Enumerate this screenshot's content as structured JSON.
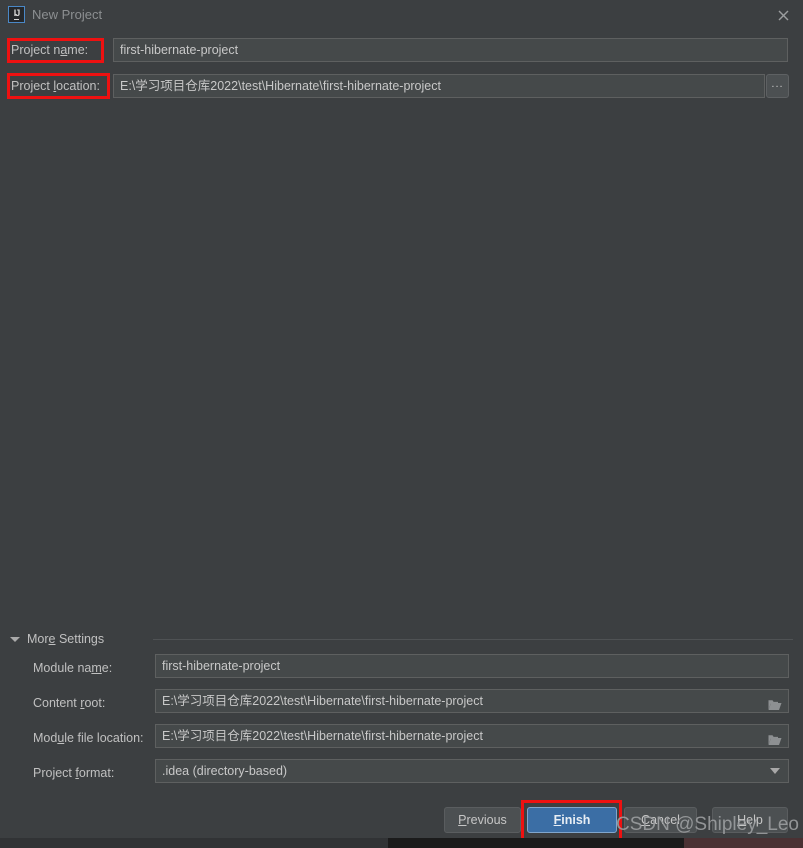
{
  "window": {
    "title": "New Project",
    "app_icon": "intellij-idea-icon",
    "icon_text": "IJ",
    "close_icon": "close-icon"
  },
  "top_form": {
    "project_name": {
      "label_pre": "Project n",
      "label_accel": "a",
      "label_post": "me:",
      "value": "first-hibernate-project"
    },
    "project_location": {
      "label_pre": "Project ",
      "label_accel": "l",
      "label_post": "ocation:",
      "value": "E:\\学习项目仓库2022\\test\\Hibernate\\first-hibernate-project"
    },
    "browse_button_label": "..."
  },
  "more_settings": {
    "header_pre": "Mor",
    "header_accel": "e",
    "header_post": " Settings",
    "expanded": true,
    "fields": [
      {
        "name": "module-name",
        "label_pre": "Module na",
        "label_accel": "m",
        "label_post": "e:",
        "value": "first-hibernate-project",
        "control": "text"
      },
      {
        "name": "content-root",
        "label_pre": "Content ",
        "label_accel": "r",
        "label_post": "oot:",
        "value": "E:\\学习项目仓库2022\\test\\Hibernate\\first-hibernate-project",
        "control": "text-with-folder"
      },
      {
        "name": "module-file-location",
        "label_pre": "Mod",
        "label_accel": "u",
        "label_post": "le file location:",
        "value": "E:\\学习项目仓库2022\\test\\Hibernate\\first-hibernate-project",
        "control": "text-with-folder"
      },
      {
        "name": "project-format",
        "label_pre": "Project ",
        "label_accel": "f",
        "label_post": "ormat:",
        "value": ".idea (directory-based)",
        "control": "combobox"
      }
    ]
  },
  "buttons": {
    "previous": {
      "pre": "",
      "accel": "P",
      "post": "revious"
    },
    "finish": {
      "pre": "",
      "accel": "F",
      "post": "inish"
    },
    "cancel": {
      "pre": "",
      "accel": "C",
      "post": "ancel"
    },
    "help": {
      "pre": "",
      "accel": "H",
      "post": "elp"
    }
  },
  "annotations": {
    "color": "#ee1111",
    "boxes": [
      "project-name-label",
      "project-location-label",
      "finish-button"
    ]
  },
  "watermark": "CSDN @Shipley_Leo",
  "colors": {
    "dialog_background": "#3c3f41",
    "field_background": "#45494a",
    "field_border": "#5e6060",
    "accent_button": "#3b6ea5",
    "annotation_red": "#ee1111",
    "text": "#c0c0c0",
    "title_text": "#8c8f91"
  }
}
